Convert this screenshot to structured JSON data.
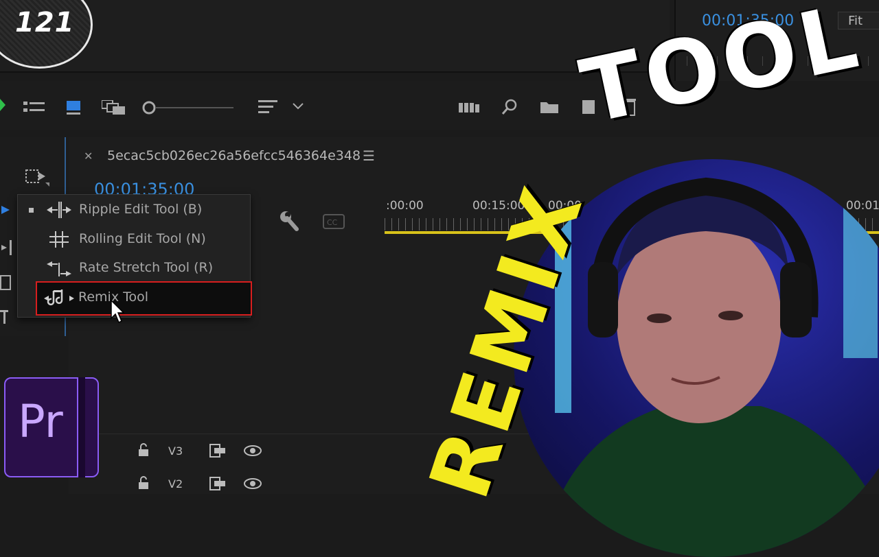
{
  "badge": {
    "number": "121"
  },
  "program_monitor": {
    "timecode": "00:01:35:00",
    "zoom": "Fit"
  },
  "sequence": {
    "name": "5ecac5cb026ec26a56efcc546364e348",
    "timecode": "00:01:35:00",
    "ruler_labels": [
      ":00:00",
      "00:15:00",
      "00:00",
      "00:01"
    ]
  },
  "tool_menu": {
    "items": [
      {
        "label": "Ripple Edit Tool (B)",
        "icon": "ripple-edit-icon",
        "selected": true
      },
      {
        "label": "Rolling Edit Tool (N)",
        "icon": "rolling-edit-icon",
        "selected": false
      },
      {
        "label": "Rate Stretch Tool (R)",
        "icon": "rate-stretch-icon",
        "selected": false
      },
      {
        "label": "Remix Tool",
        "icon": "remix-icon",
        "selected": false,
        "highlighted": true
      }
    ]
  },
  "tracks": [
    {
      "label": "V3"
    },
    {
      "label": "V2"
    }
  ],
  "overlay": {
    "title_top": "TOOL",
    "title_side": "REMIX"
  },
  "logo": {
    "text": "Pr"
  },
  "colors": {
    "timecode": "#3a90e0",
    "highlight": "#d81e1e",
    "remix_text": "#f3ea1f",
    "timeline_bar": "#d8c21a"
  }
}
